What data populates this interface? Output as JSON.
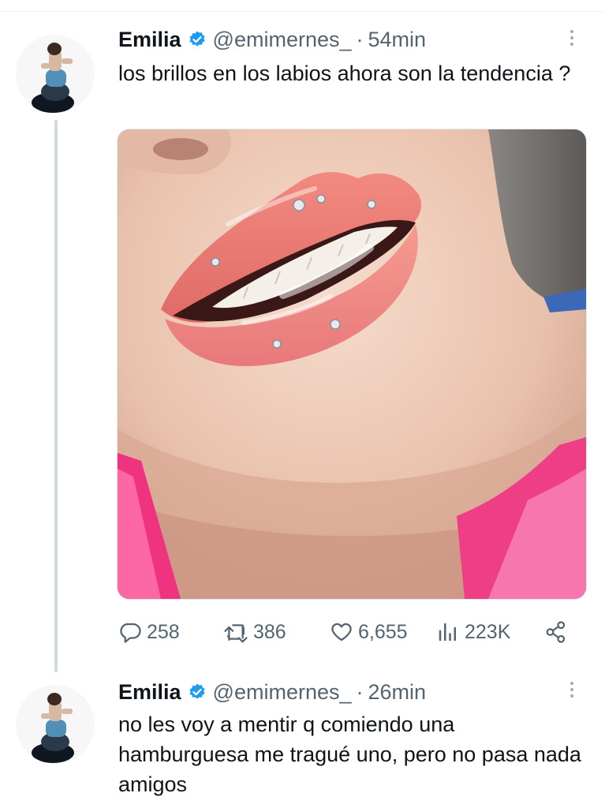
{
  "tweets": [
    {
      "name": "Emilia",
      "handle": "@emimernes_",
      "separator": "·",
      "time": "54min",
      "text": "los brillos en los labios ahora son la tendencia ?",
      "stats": {
        "replies": "258",
        "reposts": "386",
        "likes": "6,655",
        "views": "223K"
      }
    },
    {
      "name": "Emilia",
      "handle": "@emimernes_",
      "separator": "·",
      "time": "26min",
      "text": "no les voy a mentir q comiendo una hamburguesa me tragué uno, pero no pasa nada amigos"
    }
  ],
  "colors": {
    "verified": "#1d9bf0",
    "secondary_text": "#536471",
    "thread_line": "#cfd9de"
  },
  "icons": [
    "verified-badge-icon",
    "more-options-icon",
    "reply-icon",
    "repost-icon",
    "like-icon",
    "views-icon",
    "share-icon"
  ]
}
